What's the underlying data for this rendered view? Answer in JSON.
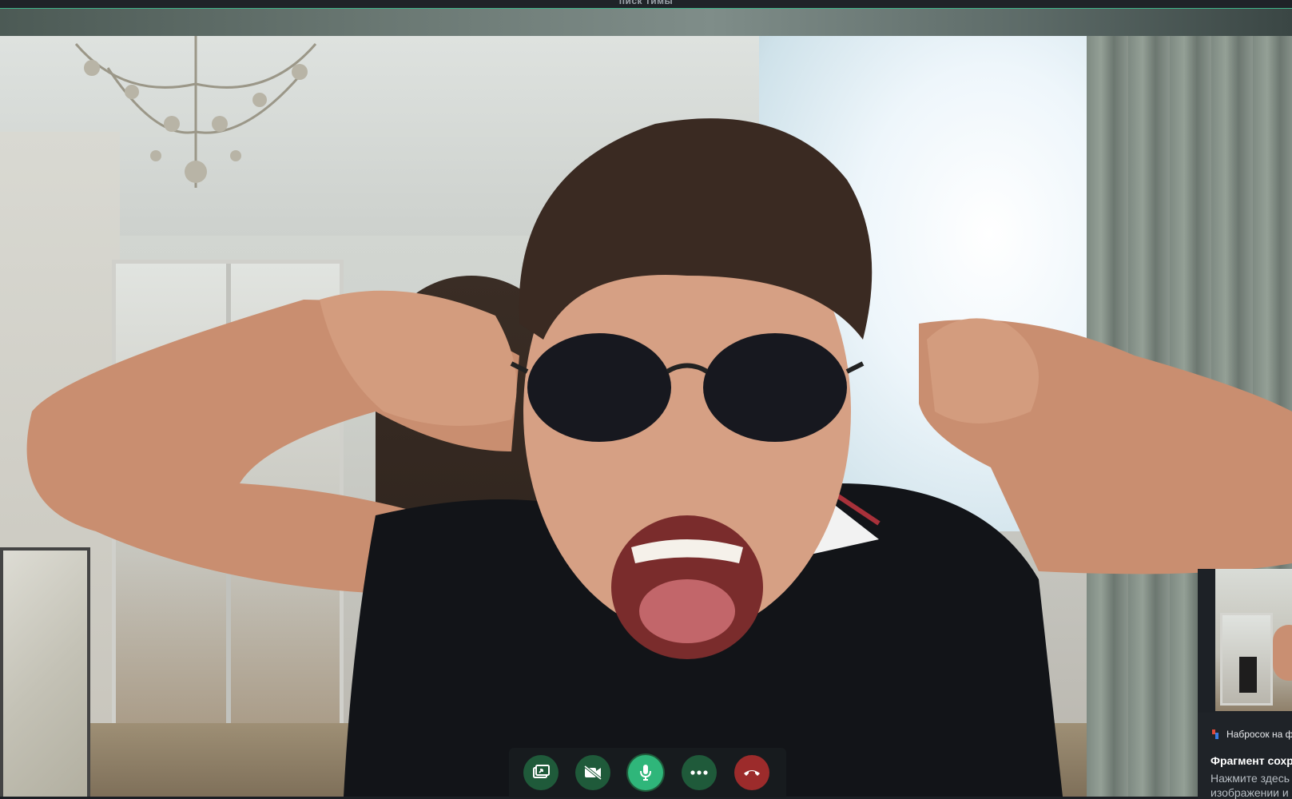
{
  "window": {
    "title": "писк тимы"
  },
  "controls": {
    "share_icon": "share-screen-icon",
    "video_icon": "video-off-icon",
    "mic_icon": "microphone-icon",
    "more_icon": "more-icon",
    "end_icon": "hang-up-icon",
    "colors": {
      "normal": "#1f5a3a",
      "mic_active": "#2fb67a",
      "end_call": "#9c2b2b"
    }
  },
  "toast": {
    "app_name": "Набросок на ф",
    "title": "Фрагмент сохр",
    "body_line1": "Нажмите здесь",
    "body_line2": "изображении и"
  }
}
